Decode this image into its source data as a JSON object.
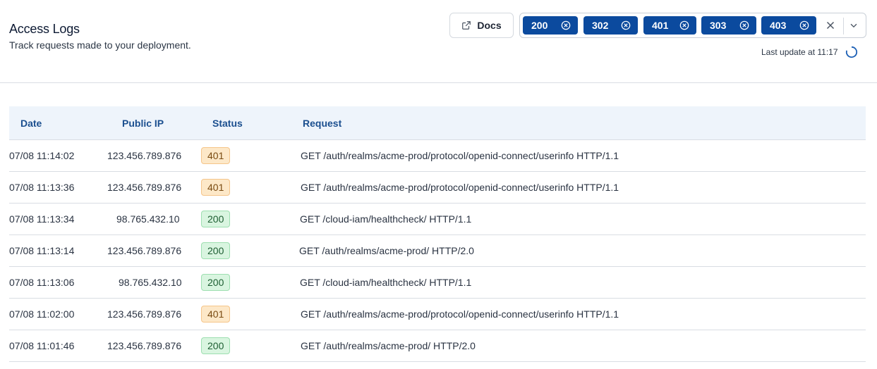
{
  "header": {
    "title": "Access Logs",
    "subtitle": "Track requests made to your deployment.",
    "docs_label": "Docs",
    "last_update": "Last update at 11:17"
  },
  "filters": {
    "chips": [
      "200",
      "302",
      "401",
      "303",
      "403"
    ]
  },
  "table": {
    "columns": [
      "Date",
      "Public IP",
      "Status",
      "Request"
    ],
    "rows": [
      {
        "date": "07/08 11:14:02",
        "ip": "123.456.789.876",
        "status": "401",
        "request": "GET /auth/realms/acme-prod/protocol/openid-connect/userinfo HTTP/1.1"
      },
      {
        "date": "07/08 11:13:36",
        "ip": "123.456.789.876",
        "status": "401",
        "request": "GET /auth/realms/acme-prod/protocol/openid-connect/userinfo HTTP/1.1"
      },
      {
        "date": "07/08 11:13:34",
        "ip": "98.765.432.10",
        "status": "200",
        "request": "GET /cloud-iam/healthcheck/ HTTP/1.1"
      },
      {
        "date": "07/08 11:13:14",
        "ip": "123.456.789.876",
        "status": "200",
        "request": "GET /auth/realms/acme-prod/ HTTP/2.0"
      },
      {
        "date": "07/08 11:13:06",
        "ip": "98.765.432.10",
        "status": "200",
        "request": "GET /cloud-iam/healthcheck/ HTTP/1.1"
      },
      {
        "date": "07/08 11:02:00",
        "ip": "123.456.789.876",
        "status": "401",
        "request": "GET /auth/realms/acme-prod/protocol/openid-connect/userinfo HTTP/1.1"
      },
      {
        "date": "07/08 11:01:46",
        "ip": "123.456.789.876",
        "status": "200",
        "request": "GET /auth/realms/acme-prod/ HTTP/2.0"
      }
    ]
  },
  "colors": {
    "chip_bg": "#0b4a9e",
    "header_text": "#1b4f8f",
    "status_ok_bg": "#d9f5e0",
    "status_err_bg": "#fde8c8"
  },
  "icons": {
    "docs": "external-link-icon",
    "chip_remove": "circle-x-icon",
    "clear": "close-icon",
    "dropdown": "chevron-down-icon",
    "refresh": "spinner-icon"
  }
}
